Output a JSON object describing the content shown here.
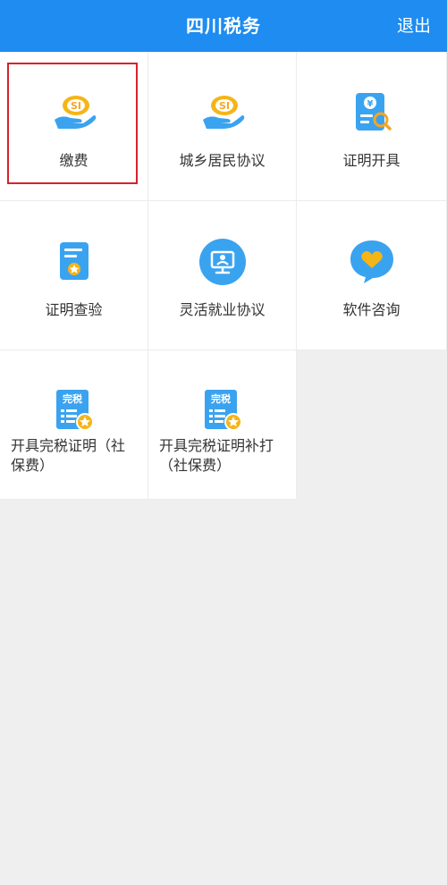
{
  "header": {
    "title": "四川税务",
    "logout_label": "退出"
  },
  "tiles": [
    {
      "label": "缴费",
      "icon": "social-insurance-hand-icon"
    },
    {
      "label": "城乡居民协议",
      "icon": "social-insurance-hand-icon"
    },
    {
      "label": "证明开具",
      "icon": "certificate-search-icon"
    },
    {
      "label": "证明查验",
      "icon": "certificate-star-icon"
    },
    {
      "label": "灵活就业协议",
      "icon": "monitor-person-icon"
    },
    {
      "label": "软件咨询",
      "icon": "heart-chat-icon"
    },
    {
      "label": "开具完税证明（社保费）",
      "icon": "tax-paid-certificate-icon",
      "badge": "完税"
    },
    {
      "label": "开具完税证明补打（社保费）",
      "icon": "tax-paid-certificate-icon",
      "badge": "完税"
    }
  ],
  "colors": {
    "header_bg": "#1e8cf0",
    "highlight_border": "#d8212c"
  }
}
